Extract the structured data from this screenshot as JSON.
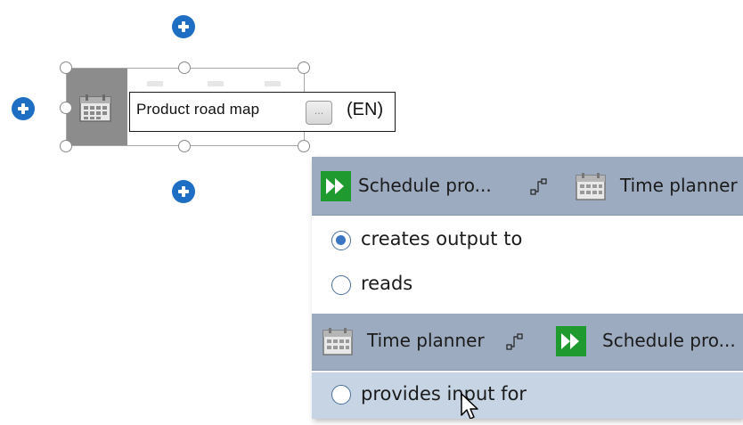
{
  "canvas": {
    "shape_name": "Product road map",
    "language": "(EN)",
    "more_button": "..."
  },
  "popup": {
    "sections": [
      {
        "from": "Schedule pro...",
        "to": "Time planner",
        "options": [
          {
            "label": "creates output to",
            "checked": true
          },
          {
            "label": "reads",
            "checked": false
          }
        ]
      },
      {
        "from": "Time planner",
        "to": "Schedule pro...",
        "options": [
          {
            "label": "provides input for",
            "checked": false,
            "hovered": true
          }
        ]
      }
    ]
  },
  "colors": {
    "accent_blue": "#1e6fc4",
    "header_bg": "#9cabbf",
    "hover_bg": "#c6d4e4",
    "function_green": "#1e9a2f"
  }
}
